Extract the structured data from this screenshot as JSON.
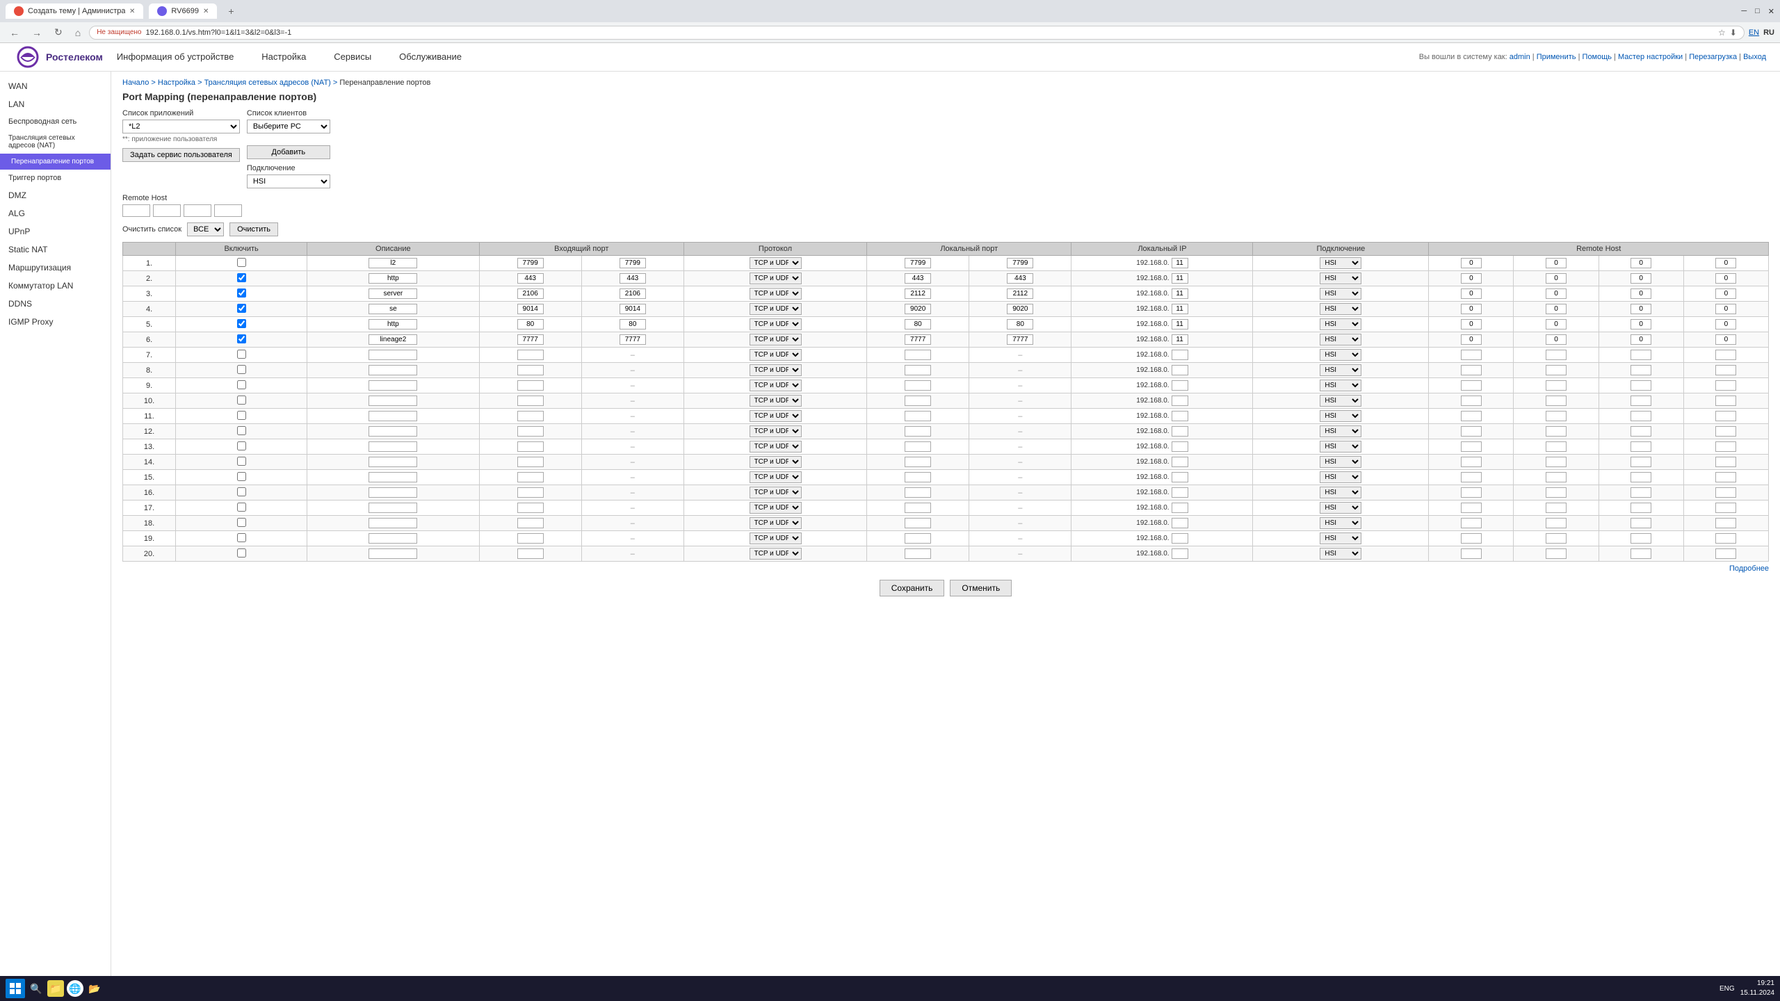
{
  "browser": {
    "tabs": [
      {
        "id": 1,
        "label": "Создать тему | Администрато...",
        "active": false,
        "icon": "red"
      },
      {
        "id": 2,
        "label": "RV6699",
        "active": true,
        "icon": "purple"
      }
    ],
    "address": "192.168.0.1/vs.htm?l0=1&l1=3&l2=0&l3=-1",
    "security_text": "Не защищено",
    "lang_en": "EN",
    "lang_ru": "RU",
    "lang_active": "RU"
  },
  "topnav": {
    "user_info": "Вы вошли в систему как:",
    "username": "admin",
    "links": [
      "Применить",
      "Помощь",
      "Мастер настройки",
      "Перезагрузка",
      "Выход"
    ]
  },
  "menu": {
    "items": [
      {
        "label": "Информация об устройстве"
      },
      {
        "label": "Настройка"
      },
      {
        "label": "Сервисы"
      },
      {
        "label": "Обслуживание"
      }
    ]
  },
  "sidebar": {
    "items": [
      {
        "label": "WAN",
        "active": false,
        "indent": false
      },
      {
        "label": "LAN",
        "active": false,
        "indent": false
      },
      {
        "label": "Беспроводная сеть",
        "active": false,
        "indent": false
      },
      {
        "label": "Трансляция сетевых адресов (NAT)",
        "active": false,
        "indent": false
      },
      {
        "label": "Перенаправление портов",
        "active": true,
        "indent": true
      },
      {
        "label": "Триггер портов",
        "active": false,
        "indent": false
      },
      {
        "label": "DMZ",
        "active": false,
        "indent": false
      },
      {
        "label": "ALG",
        "active": false,
        "indent": false
      },
      {
        "label": "UPnP",
        "active": false,
        "indent": false
      },
      {
        "label": "Static NAT",
        "active": false,
        "indent": false
      },
      {
        "label": "Маршрутизация",
        "active": false,
        "indent": false
      },
      {
        "label": "Коммутатор LAN",
        "active": false,
        "indent": false
      },
      {
        "label": "DDNS",
        "active": false,
        "indent": false
      },
      {
        "label": "IGMP Proxy",
        "active": false,
        "indent": false
      }
    ]
  },
  "breadcrumb": {
    "items": [
      "Начало",
      "Настройка",
      "Трансляция сетевых адресов (NAT)",
      "Перенаправление портов"
    ]
  },
  "page": {
    "title": "Port Mapping (перенаправление портов)"
  },
  "form": {
    "app_list_label": "Список приложений",
    "app_list_value": "*L2",
    "app_list_note": "**: приложение пользователя",
    "service_button": "Задать сервис пользователя",
    "client_list_label": "Список клиентов",
    "client_list_placeholder": "Выберите РС",
    "add_button": "Добавить",
    "connection_label": "Подключение",
    "connection_value": "HSI",
    "remote_host_label": "Remote Host",
    "filter_label": "Очистить список",
    "filter_value": "ВСЕ",
    "clear_button": "Очистить"
  },
  "table": {
    "headers": [
      "Включить",
      "Описание",
      "Входящий порт",
      "Протокол",
      "Локальный порт",
      "Локальный IP",
      "Подключение",
      "Remote Host"
    ],
    "rows": [
      {
        "num": 1,
        "checked": false,
        "desc": "l2",
        "in_port_from": "7799",
        "in_port_to": "7799",
        "proto": "TCP и UDP",
        "loc_port_from": "7799",
        "loc_port_to": "7799",
        "loc_ip": "192.168.0.",
        "loc_ip_last": "11",
        "conn": "HSI",
        "rh1": "0",
        "rh2": "0",
        "rh3": "0",
        "rh4": "0"
      },
      {
        "num": 2,
        "checked": true,
        "desc": "http",
        "in_port_from": "443",
        "in_port_to": "443",
        "proto": "TCP и UDP",
        "loc_port_from": "443",
        "loc_port_to": "443",
        "loc_ip": "192.168.0.",
        "loc_ip_last": "11",
        "conn": "HSI",
        "rh1": "0",
        "rh2": "0",
        "rh3": "0",
        "rh4": "0"
      },
      {
        "num": 3,
        "checked": true,
        "desc": "server",
        "in_port_from": "2106",
        "in_port_to": "2106",
        "proto": "TCP и UDP",
        "loc_port_from": "2112",
        "loc_port_to": "2112",
        "loc_ip": "192.168.0.",
        "loc_ip_last": "11",
        "conn": "HSI",
        "rh1": "0",
        "rh2": "0",
        "rh3": "0",
        "rh4": "0"
      },
      {
        "num": 4,
        "checked": true,
        "desc": "se",
        "in_port_from": "9014",
        "in_port_to": "9014",
        "proto": "TCP и UDP",
        "loc_port_from": "9020",
        "loc_port_to": "9020",
        "loc_ip": "192.168.0.",
        "loc_ip_last": "11",
        "conn": "HSI",
        "rh1": "0",
        "rh2": "0",
        "rh3": "0",
        "rh4": "0"
      },
      {
        "num": 5,
        "checked": true,
        "desc": "http",
        "in_port_from": "80",
        "in_port_to": "80",
        "proto": "TCP и UDP",
        "loc_port_from": "80",
        "loc_port_to": "80",
        "loc_ip": "192.168.0.",
        "loc_ip_last": "11",
        "conn": "HSI",
        "rh1": "0",
        "rh2": "0",
        "rh3": "0",
        "rh4": "0"
      },
      {
        "num": 6,
        "checked": true,
        "desc": "lineage2",
        "in_port_from": "7777",
        "in_port_to": "7777",
        "proto": "TCP и UDP",
        "loc_port_from": "7777",
        "loc_port_to": "7777",
        "loc_ip": "192.168.0.",
        "loc_ip_last": "11",
        "conn": "HSI",
        "rh1": "0",
        "rh2": "0",
        "rh3": "0",
        "rh4": "0"
      },
      {
        "num": 7,
        "checked": false,
        "desc": "",
        "in_port_from": "",
        "in_port_to": "–",
        "proto": "TCP и UDP",
        "loc_port_from": "",
        "loc_port_to": "–",
        "loc_ip": "192.168.0.",
        "loc_ip_last": "",
        "conn": "HSI"
      },
      {
        "num": 8,
        "checked": false,
        "desc": "",
        "in_port_from": "",
        "in_port_to": "–",
        "proto": "TCP и UDP",
        "loc_port_from": "",
        "loc_port_to": "–",
        "loc_ip": "192.168.0.",
        "loc_ip_last": "",
        "conn": "HSI"
      },
      {
        "num": 9,
        "checked": false,
        "desc": "",
        "in_port_from": "",
        "in_port_to": "–",
        "proto": "TCP и UDP",
        "loc_port_from": "",
        "loc_port_to": "–",
        "loc_ip": "192.168.0.",
        "loc_ip_last": "",
        "conn": "HSI"
      },
      {
        "num": 10,
        "checked": false,
        "desc": "",
        "in_port_from": "",
        "in_port_to": "–",
        "proto": "TCP и UDP",
        "loc_port_from": "",
        "loc_port_to": "–",
        "loc_ip": "192.168.0.",
        "loc_ip_last": "",
        "conn": "HSI"
      },
      {
        "num": 11,
        "checked": false,
        "desc": "",
        "in_port_from": "",
        "in_port_to": "–",
        "proto": "TCP и UDP",
        "loc_port_from": "",
        "loc_port_to": "–",
        "loc_ip": "192.168.0.",
        "loc_ip_last": "",
        "conn": "HSI"
      },
      {
        "num": 12,
        "checked": false,
        "desc": "",
        "in_port_from": "",
        "in_port_to": "–",
        "proto": "TCP и UDP",
        "loc_port_from": "",
        "loc_port_to": "–",
        "loc_ip": "192.168.0.",
        "loc_ip_last": "",
        "conn": "HSI"
      },
      {
        "num": 13,
        "checked": false,
        "desc": "",
        "in_port_from": "",
        "in_port_to": "–",
        "proto": "TCP и UDP",
        "loc_port_from": "",
        "loc_port_to": "–",
        "loc_ip": "192.168.0.",
        "loc_ip_last": "",
        "conn": "HSI"
      },
      {
        "num": 14,
        "checked": false,
        "desc": "",
        "in_port_from": "",
        "in_port_to": "–",
        "proto": "TCP и UDP",
        "loc_port_from": "",
        "loc_port_to": "–",
        "loc_ip": "192.168.0.",
        "loc_ip_last": "",
        "conn": "HSI"
      },
      {
        "num": 15,
        "checked": false,
        "desc": "",
        "in_port_from": "",
        "in_port_to": "–",
        "proto": "TCP и UDP",
        "loc_port_from": "",
        "loc_port_to": "–",
        "loc_ip": "192.168.0.",
        "loc_ip_last": "",
        "conn": "HSI"
      },
      {
        "num": 16,
        "checked": false,
        "desc": "",
        "in_port_from": "",
        "in_port_to": "–",
        "proto": "TCP и UDP",
        "loc_port_from": "",
        "loc_port_to": "–",
        "loc_ip": "192.168.0.",
        "loc_ip_last": "",
        "conn": "HSI"
      },
      {
        "num": 17,
        "checked": false,
        "desc": "",
        "in_port_from": "",
        "in_port_to": "–",
        "proto": "TCP и UDP",
        "loc_port_from": "",
        "loc_port_to": "–",
        "loc_ip": "192.168.0.",
        "loc_ip_last": "",
        "conn": "HSI"
      },
      {
        "num": 18,
        "checked": false,
        "desc": "",
        "in_port_from": "",
        "in_port_to": "–",
        "proto": "TCP и UDP",
        "loc_port_from": "",
        "loc_port_to": "–",
        "loc_ip": "192.168.0.",
        "loc_ip_last": "",
        "conn": "HSI"
      },
      {
        "num": 19,
        "checked": false,
        "desc": "",
        "in_port_from": "",
        "in_port_to": "–",
        "proto": "TCP и UDP",
        "loc_port_from": "",
        "loc_port_to": "–",
        "loc_ip": "192.168.0.",
        "loc_ip_last": "",
        "conn": "HSI"
      },
      {
        "num": 20,
        "checked": false,
        "desc": "",
        "in_port_from": "",
        "in_port_to": "–",
        "proto": "TCP и UDP",
        "loc_port_from": "",
        "loc_port_to": "–",
        "loc_ip": "192.168.0.",
        "loc_ip_last": "",
        "conn": "HSI"
      }
    ],
    "more_label": "Подробнее"
  },
  "actions": {
    "save": "Сохранить",
    "cancel": "Отменить"
  },
  "taskbar": {
    "time": "19:21",
    "date": "15.11.2024",
    "lang": "ENG"
  }
}
